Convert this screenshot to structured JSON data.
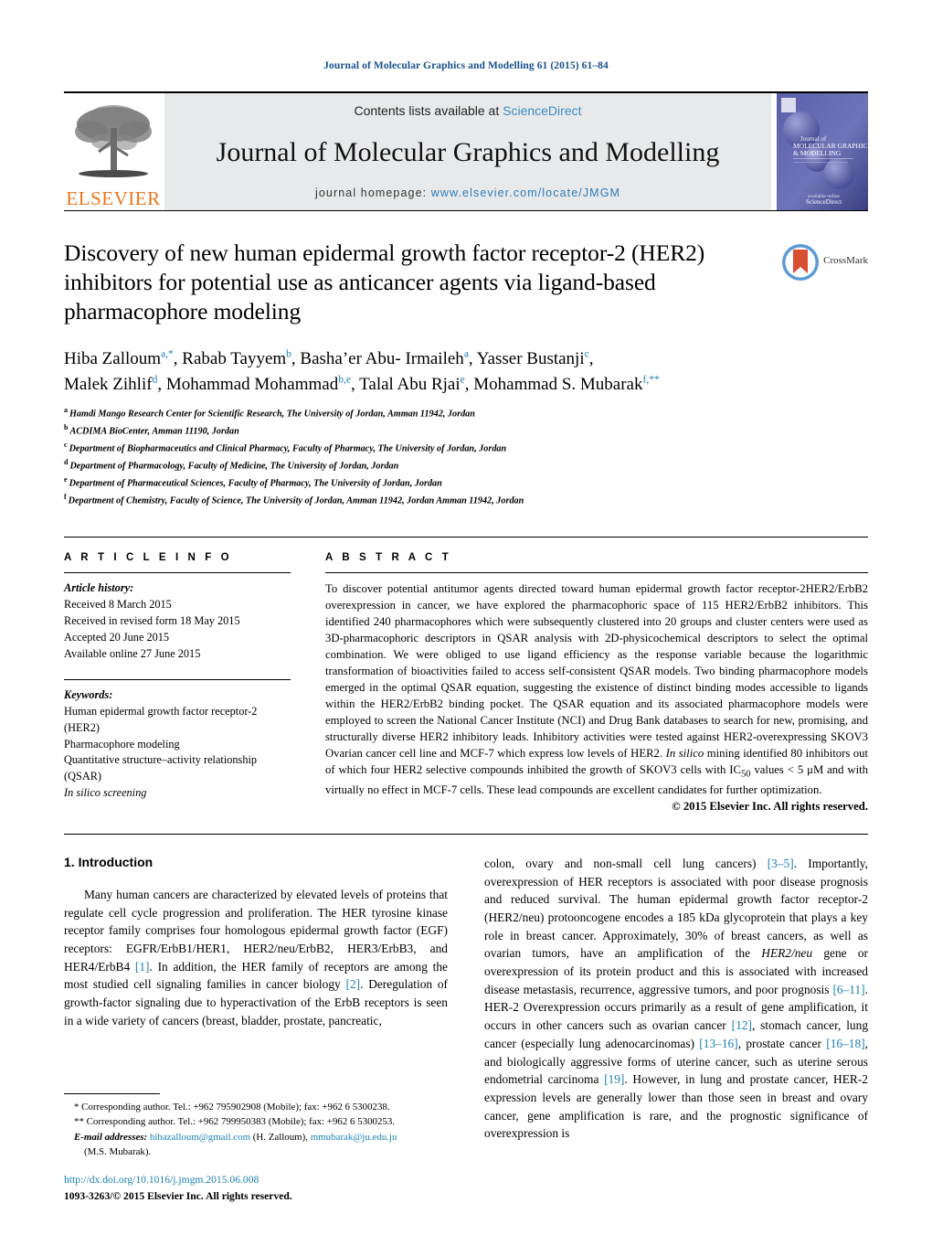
{
  "running_head": "Journal of Molecular Graphics and Modelling 61 (2015) 61–84",
  "masthead": {
    "contents_prefix": "Contents lists available at ",
    "contents_link": "ScienceDirect",
    "journal_title": "Journal of Molecular Graphics and Modelling",
    "homepage_prefix": "journal homepage:",
    "homepage_url": "www.elsevier.com/locate/JMGM",
    "publisher_name": "ELSEVIER",
    "cover_title_line1": "MOLECULAR GRAPHICS",
    "cover_title_line2": "& MODELLING",
    "brand_orange": "#E87722",
    "link_blue": "#2b7bb9"
  },
  "article": {
    "title": "Discovery of new human epidermal growth factor receptor-2 (HER2) inhibitors for potential use as anticancer agents via ligand-based pharmacophore modeling",
    "crossmark_label": "CrossMark",
    "authors_line1": [
      {
        "name": "Hiba Zalloum",
        "sup": "a,*"
      },
      {
        "name": "Rabab Tayyem",
        "sup": "b"
      },
      {
        "name": "Basha’er Abu- Irmaileh",
        "sup": "a"
      },
      {
        "name": "Yasser Bustanji",
        "sup": "c"
      }
    ],
    "authors_line2": [
      {
        "name": "Malek Zihlif",
        "sup": "d"
      },
      {
        "name": "Mohammad Mohammad",
        "sup": "b,e"
      },
      {
        "name": "Talal Abu Rjai",
        "sup": "e"
      },
      {
        "name": "Mohammad S. Mubarak",
        "sup": "f,**"
      }
    ],
    "affiliations": [
      {
        "mark": "a",
        "text": "Hamdi Mango Research Center for Scientific Research, The University of Jordan, Amman 11942, Jordan"
      },
      {
        "mark": "b",
        "text": "ACDIMA BioCenter, Amman 11190, Jordan"
      },
      {
        "mark": "c",
        "text": "Department of Biopharmaceutics and Clinical Pharmacy, Faculty of Pharmacy, The University of Jordan, Jordan"
      },
      {
        "mark": "d",
        "text": "Department of Pharmacology, Faculty of Medicine, The University of Jordan, Jordan"
      },
      {
        "mark": "e",
        "text": "Department of Pharmaceutical Sciences, Faculty of Pharmacy, The University of Jordan, Jordan"
      },
      {
        "mark": "f",
        "text": "Department of Chemistry, Faculty of Science, The University of Jordan, Amman 11942, Jordan Amman 11942, Jordan"
      }
    ]
  },
  "article_info": {
    "heading": "A R T I C L E   I N F O",
    "history_label": "Article history:",
    "history": [
      "Received 8 March 2015",
      "Received in revised form 18 May 2015",
      "Accepted 20 June 2015",
      "Available online 27 June 2015"
    ],
    "keywords_label": "Keywords:",
    "keywords": [
      "Human epidermal growth factor receptor-2 (HER2)",
      "Pharmacophore modeling",
      "Quantitative structure–activity relationship (QSAR)",
      "In silico screening"
    ]
  },
  "abstract": {
    "heading": "A B S T R A C T",
    "part1": "To discover potential antitumor agents directed toward human epidermal growth factor receptor-2HER2/ErbB2 overexpression in cancer, we have explored the pharmacophoric space of 115 HER2/ErbB2 inhibitors. This identified 240 pharmacophores which were subsequently clustered into 20 groups and cluster centers were used as 3D-pharmacophoric descriptors in QSAR analysis with 2D-physicochemical descriptors to select the optimal combination. We were obliged to use ligand efficiency as the response variable because the logarithmic transformation of bioactivities failed to access self-consistent QSAR models. Two binding pharmacophore models emerged in the optimal QSAR equation, suggesting the existence of distinct binding modes accessible to ligands within the HER2/ErbB2 binding pocket. The QSAR equation and its associated pharmacophore models were employed to screen the National Cancer Institute (NCI) and Drug Bank databases to search for new, promising, and structurally diverse HER2 inhibitory leads. Inhibitory activities were tested against HER2-overexpressing SKOV3 Ovarian cancer cell line and MCF-7 which express low levels of HER2. ",
    "italic1": "In silico",
    "part2": " mining identified 80 inhibitors out of which four HER2 selective compounds inhibited the growth of SKOV3 cells with IC",
    "sub1": "50",
    "part3": " values < 5 μM and with virtually no effect in MCF-7 cells. These lead compounds are excellent candidates for further optimization.",
    "copyright": "© 2015 Elsevier Inc. All rights reserved."
  },
  "intro": {
    "heading": "1.  Introduction",
    "left_p1_a": "Many human cancers are characterized by elevated levels of proteins that regulate cell cycle progression and proliferation. The HER tyrosine kinase receptor family comprises four homologous epidermal growth factor (EGF) receptors: EGFR/ErbB1/HER1, HER2/neu/ErbB2, HER3/ErbB3, and HER4/ErbB4 ",
    "ref1": "[1]",
    "left_p1_b": ". In addition, the HER family of receptors are among the most studied cell signaling families in cancer biology ",
    "ref2": "[2]",
    "left_p1_c": ". Deregulation of growth-factor signaling due to hyperactivation of the ErbB receptors is seen in a wide variety of cancers (breast, bladder, prostate, pancreatic, ",
    "right_a": "colon, ovary and non-small cell lung cancers) ",
    "ref3": "[3–5]",
    "right_b": ". Importantly, overexpression of HER receptors is associated with poor disease prognosis and reduced survival. The human epidermal growth factor receptor-2 (HER2/neu) protooncogene encodes a 185 kDa glycoprotein that plays a key role in breast cancer. Approximately, 30% of breast cancers, as well as ovarian tumors, have an amplification of the ",
    "ital1": "HER2/neu",
    "right_c": " gene or overexpression of its protein product and this is associated with increased disease metastasis, recurrence, aggressive tumors, and poor prognosis ",
    "ref4": "[6–11]",
    "right_d": ". HER-2 Overexpression occurs primarily as a result of gene amplification, it occurs in other cancers such as ovarian cancer ",
    "ref5": "[12]",
    "right_e": ", stomach cancer, lung cancer (especially lung adenocarcinomas) ",
    "ref6": "[13–16]",
    "right_f": ", prostate cancer ",
    "ref7": "[16–18]",
    "right_g": ", and biologically aggressive forms of uterine cancer, such as uterine serous endometrial carcinoma ",
    "ref8": "[19]",
    "right_h": ". However, in lung and prostate cancer, HER-2 expression levels are generally lower than those seen in breast and ovary cancer, gene amplification is rare, and the prognostic significance of overexpression is"
  },
  "footnotes": {
    "line1": "*  Corresponding author. Tel.: +962 795902908 (Mobile); fax: +962 6 5300238.",
    "line2": "**  Corresponding author. Tel.: +962 799950383 (Mobile); fax: +962 6 5300253.",
    "email_label": "E-mail addresses:",
    "email1": "hibazalloum@gmail.com",
    "email1_owner": " (H. Zalloum), ",
    "email2": "mmubarak@ju.edu.ju",
    "email2_owner": "(M.S. Mubarak).",
    "doi": "http://dx.doi.org/10.1016/j.jmgm.2015.06.008",
    "issn": "1093-3263/© 2015 Elsevier Inc. All rights reserved."
  }
}
